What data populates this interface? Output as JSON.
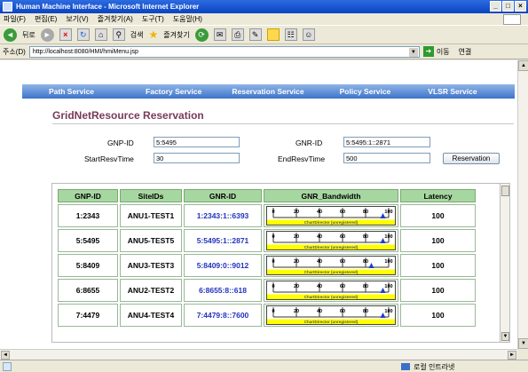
{
  "window": {
    "title": "Human Machine Interface - Microsoft Internet Explorer"
  },
  "menu": [
    "파일(F)",
    "편집(E)",
    "보기(V)",
    "즐겨찾기(A)",
    "도구(T)",
    "도움말(H)"
  ],
  "toolbar": {
    "back": "뒤로",
    "search": "검색",
    "favorites": "즐겨찾기"
  },
  "address": {
    "label": "주소(D)",
    "url": "http://localhost:8080/HMI/hmiMenu.jsp",
    "go": "이동",
    "links": "연결"
  },
  "nav": [
    "Path Service",
    "Factory Service",
    "Reservation Service",
    "Policy Service",
    "VLSR Service"
  ],
  "reservation": {
    "title": "GridNetResource Reservation",
    "gnp_id_label": "GNP-ID",
    "gnp_id_value": "5:5495",
    "gnr_id_label": "GNR-ID",
    "gnr_id_value": "5:5495:1::2871",
    "start_label": "StartResvTime",
    "start_value": "30",
    "end_label": "EndResvTime",
    "end_value": "500",
    "button": "Reservation"
  },
  "table": {
    "headers": [
      "GNP-ID",
      "SiteIDs",
      "GNR-ID",
      "GNR_Bandwidth",
      "Latency"
    ],
    "bandwidth_ticks": [
      "0",
      "20",
      "40",
      "60",
      "80",
      "100"
    ],
    "watermark": "ChartDirector (unregistered)",
    "rows": [
      {
        "gnp": "1:2343",
        "site": "ANU1-TEST1",
        "gnr": "1:2343:1::6393",
        "bandwidth": 95,
        "latency": "100"
      },
      {
        "gnp": "5:5495",
        "site": "ANU5-TEST5",
        "gnr": "5:5495:1::2871",
        "bandwidth": 95,
        "latency": "100"
      },
      {
        "gnp": "5:8409",
        "site": "ANU3-TEST3",
        "gnr": "5:8409:0::9012",
        "bandwidth": 85,
        "latency": "100"
      },
      {
        "gnp": "6:8655",
        "site": "ANU2-TEST2",
        "gnr": "6:8655:8::618",
        "bandwidth": 95,
        "latency": "100"
      },
      {
        "gnp": "7:4479",
        "site": "ANU4-TEST4",
        "gnr": "7:4479:8::7600",
        "bandwidth": 95,
        "latency": "100"
      }
    ]
  },
  "status": {
    "zone": "로컬 인트라넷"
  },
  "colors": {
    "title_gradient": "#0a44c2",
    "nav_gradient": "#3d74c9",
    "header_green": "#a7d7a0",
    "gnr_text": "#2233bb",
    "title_maroon": "#7a3a5a"
  }
}
